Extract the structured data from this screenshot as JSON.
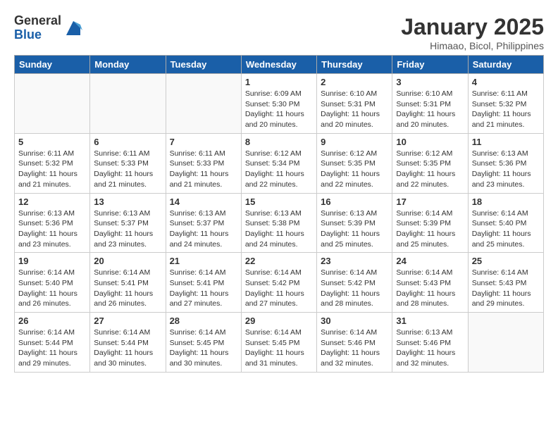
{
  "header": {
    "logo_general": "General",
    "logo_blue": "Blue",
    "month_title": "January 2025",
    "location": "Himaao, Bicol, Philippines"
  },
  "days_of_week": [
    "Sunday",
    "Monday",
    "Tuesday",
    "Wednesday",
    "Thursday",
    "Friday",
    "Saturday"
  ],
  "weeks": [
    [
      {
        "day": "",
        "sunrise": "",
        "sunset": "",
        "daylight": ""
      },
      {
        "day": "",
        "sunrise": "",
        "sunset": "",
        "daylight": ""
      },
      {
        "day": "",
        "sunrise": "",
        "sunset": "",
        "daylight": ""
      },
      {
        "day": "1",
        "sunrise": "Sunrise: 6:09 AM",
        "sunset": "Sunset: 5:30 PM",
        "daylight": "Daylight: 11 hours and 20 minutes."
      },
      {
        "day": "2",
        "sunrise": "Sunrise: 6:10 AM",
        "sunset": "Sunset: 5:31 PM",
        "daylight": "Daylight: 11 hours and 20 minutes."
      },
      {
        "day": "3",
        "sunrise": "Sunrise: 6:10 AM",
        "sunset": "Sunset: 5:31 PM",
        "daylight": "Daylight: 11 hours and 20 minutes."
      },
      {
        "day": "4",
        "sunrise": "Sunrise: 6:11 AM",
        "sunset": "Sunset: 5:32 PM",
        "daylight": "Daylight: 11 hours and 21 minutes."
      }
    ],
    [
      {
        "day": "5",
        "sunrise": "Sunrise: 6:11 AM",
        "sunset": "Sunset: 5:32 PM",
        "daylight": "Daylight: 11 hours and 21 minutes."
      },
      {
        "day": "6",
        "sunrise": "Sunrise: 6:11 AM",
        "sunset": "Sunset: 5:33 PM",
        "daylight": "Daylight: 11 hours and 21 minutes."
      },
      {
        "day": "7",
        "sunrise": "Sunrise: 6:11 AM",
        "sunset": "Sunset: 5:33 PM",
        "daylight": "Daylight: 11 hours and 21 minutes."
      },
      {
        "day": "8",
        "sunrise": "Sunrise: 6:12 AM",
        "sunset": "Sunset: 5:34 PM",
        "daylight": "Daylight: 11 hours and 22 minutes."
      },
      {
        "day": "9",
        "sunrise": "Sunrise: 6:12 AM",
        "sunset": "Sunset: 5:35 PM",
        "daylight": "Daylight: 11 hours and 22 minutes."
      },
      {
        "day": "10",
        "sunrise": "Sunrise: 6:12 AM",
        "sunset": "Sunset: 5:35 PM",
        "daylight": "Daylight: 11 hours and 22 minutes."
      },
      {
        "day": "11",
        "sunrise": "Sunrise: 6:13 AM",
        "sunset": "Sunset: 5:36 PM",
        "daylight": "Daylight: 11 hours and 23 minutes."
      }
    ],
    [
      {
        "day": "12",
        "sunrise": "Sunrise: 6:13 AM",
        "sunset": "Sunset: 5:36 PM",
        "daylight": "Daylight: 11 hours and 23 minutes."
      },
      {
        "day": "13",
        "sunrise": "Sunrise: 6:13 AM",
        "sunset": "Sunset: 5:37 PM",
        "daylight": "Daylight: 11 hours and 23 minutes."
      },
      {
        "day": "14",
        "sunrise": "Sunrise: 6:13 AM",
        "sunset": "Sunset: 5:37 PM",
        "daylight": "Daylight: 11 hours and 24 minutes."
      },
      {
        "day": "15",
        "sunrise": "Sunrise: 6:13 AM",
        "sunset": "Sunset: 5:38 PM",
        "daylight": "Daylight: 11 hours and 24 minutes."
      },
      {
        "day": "16",
        "sunrise": "Sunrise: 6:13 AM",
        "sunset": "Sunset: 5:39 PM",
        "daylight": "Daylight: 11 hours and 25 minutes."
      },
      {
        "day": "17",
        "sunrise": "Sunrise: 6:14 AM",
        "sunset": "Sunset: 5:39 PM",
        "daylight": "Daylight: 11 hours and 25 minutes."
      },
      {
        "day": "18",
        "sunrise": "Sunrise: 6:14 AM",
        "sunset": "Sunset: 5:40 PM",
        "daylight": "Daylight: 11 hours and 25 minutes."
      }
    ],
    [
      {
        "day": "19",
        "sunrise": "Sunrise: 6:14 AM",
        "sunset": "Sunset: 5:40 PM",
        "daylight": "Daylight: 11 hours and 26 minutes."
      },
      {
        "day": "20",
        "sunrise": "Sunrise: 6:14 AM",
        "sunset": "Sunset: 5:41 PM",
        "daylight": "Daylight: 11 hours and 26 minutes."
      },
      {
        "day": "21",
        "sunrise": "Sunrise: 6:14 AM",
        "sunset": "Sunset: 5:41 PM",
        "daylight": "Daylight: 11 hours and 27 minutes."
      },
      {
        "day": "22",
        "sunrise": "Sunrise: 6:14 AM",
        "sunset": "Sunset: 5:42 PM",
        "daylight": "Daylight: 11 hours and 27 minutes."
      },
      {
        "day": "23",
        "sunrise": "Sunrise: 6:14 AM",
        "sunset": "Sunset: 5:42 PM",
        "daylight": "Daylight: 11 hours and 28 minutes."
      },
      {
        "day": "24",
        "sunrise": "Sunrise: 6:14 AM",
        "sunset": "Sunset: 5:43 PM",
        "daylight": "Daylight: 11 hours and 28 minutes."
      },
      {
        "day": "25",
        "sunrise": "Sunrise: 6:14 AM",
        "sunset": "Sunset: 5:43 PM",
        "daylight": "Daylight: 11 hours and 29 minutes."
      }
    ],
    [
      {
        "day": "26",
        "sunrise": "Sunrise: 6:14 AM",
        "sunset": "Sunset: 5:44 PM",
        "daylight": "Daylight: 11 hours and 29 minutes."
      },
      {
        "day": "27",
        "sunrise": "Sunrise: 6:14 AM",
        "sunset": "Sunset: 5:44 PM",
        "daylight": "Daylight: 11 hours and 30 minutes."
      },
      {
        "day": "28",
        "sunrise": "Sunrise: 6:14 AM",
        "sunset": "Sunset: 5:45 PM",
        "daylight": "Daylight: 11 hours and 30 minutes."
      },
      {
        "day": "29",
        "sunrise": "Sunrise: 6:14 AM",
        "sunset": "Sunset: 5:45 PM",
        "daylight": "Daylight: 11 hours and 31 minutes."
      },
      {
        "day": "30",
        "sunrise": "Sunrise: 6:14 AM",
        "sunset": "Sunset: 5:46 PM",
        "daylight": "Daylight: 11 hours and 32 minutes."
      },
      {
        "day": "31",
        "sunrise": "Sunrise: 6:13 AM",
        "sunset": "Sunset: 5:46 PM",
        "daylight": "Daylight: 11 hours and 32 minutes."
      },
      {
        "day": "",
        "sunrise": "",
        "sunset": "",
        "daylight": ""
      }
    ]
  ]
}
